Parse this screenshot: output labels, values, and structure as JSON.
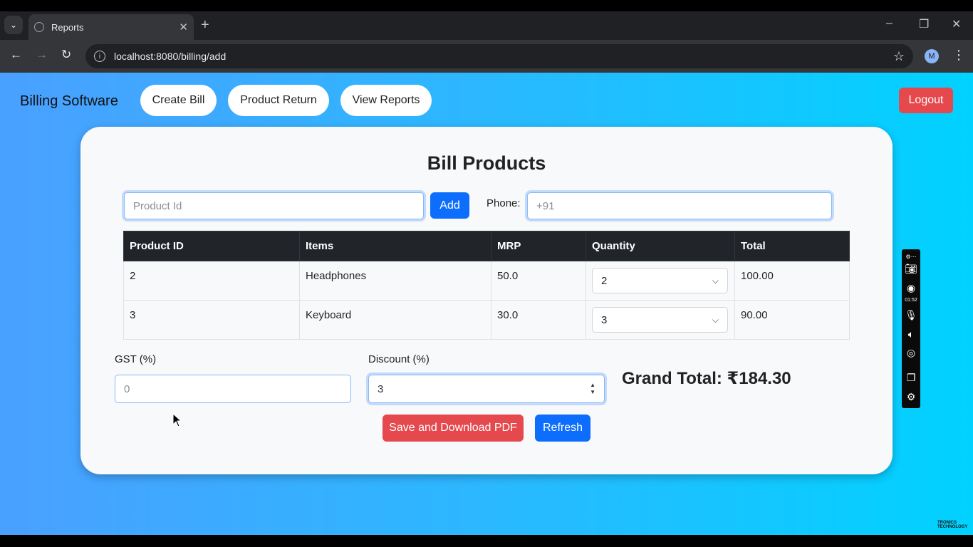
{
  "browser": {
    "tab_title": "Reports",
    "url": "localhost:8080/billing/add",
    "profile_initial": "M"
  },
  "nav": {
    "brand": "Billing Software",
    "links": [
      "Create Bill",
      "Product Return",
      "View Reports"
    ],
    "logout": "Logout"
  },
  "bill": {
    "title": "Bill Products",
    "product_id_placeholder": "Product Id",
    "add_label": "Add",
    "phone_label": "Phone:",
    "phone_placeholder": "+91",
    "columns": [
      "Product ID",
      "Items",
      "MRP",
      "Quantity",
      "Total"
    ],
    "rows": [
      {
        "id": "2",
        "item": "Headphones",
        "mrp": "50.0",
        "qty": "2",
        "total": "100.00"
      },
      {
        "id": "3",
        "item": "Keyboard",
        "mrp": "30.0",
        "qty": "3",
        "total": "90.00"
      }
    ],
    "gst_label": "GST (%)",
    "gst_value": "0",
    "discount_label": "Discount (%)",
    "discount_value": "3",
    "grand_total": "Grand Total: ₹184.30",
    "save_label": "Save and Download PDF",
    "refresh_label": "Refresh"
  },
  "recorder": {
    "time": "01:52"
  },
  "watermark": [
    "TRONICS",
    "TECHNOLOGY"
  ],
  "colors": {
    "primary": "#0d6efd",
    "danger": "#e5484d",
    "table_header": "#212529"
  }
}
